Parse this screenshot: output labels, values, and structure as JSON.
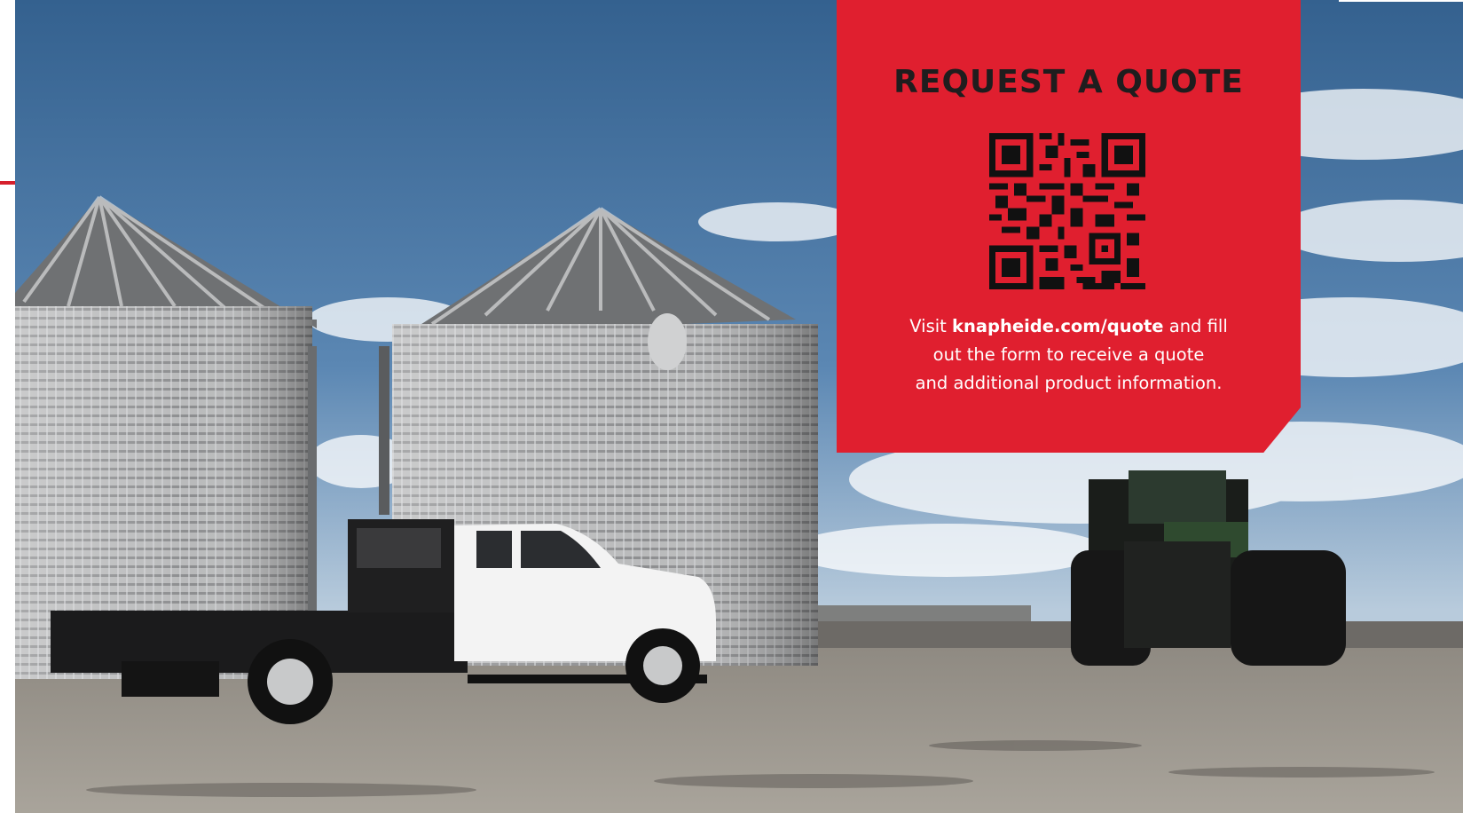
{
  "quote_card": {
    "title": "REQUEST A QUOTE",
    "line1_prefix": "Visit ",
    "link_text": "knapheide.com/quote",
    "line1_suffix": " and fill",
    "line2": "out the form to receive a quote",
    "line3": "and additional product information."
  },
  "photo": {
    "subject": "Grain bins with white flatbed pickup truck and green tractor"
  },
  "colors": {
    "card_red": "#e01f2f",
    "title_dark": "#1f1d1e",
    "accent_red": "#d61f2c"
  },
  "icons": {
    "qr": "qr-code-icon"
  }
}
